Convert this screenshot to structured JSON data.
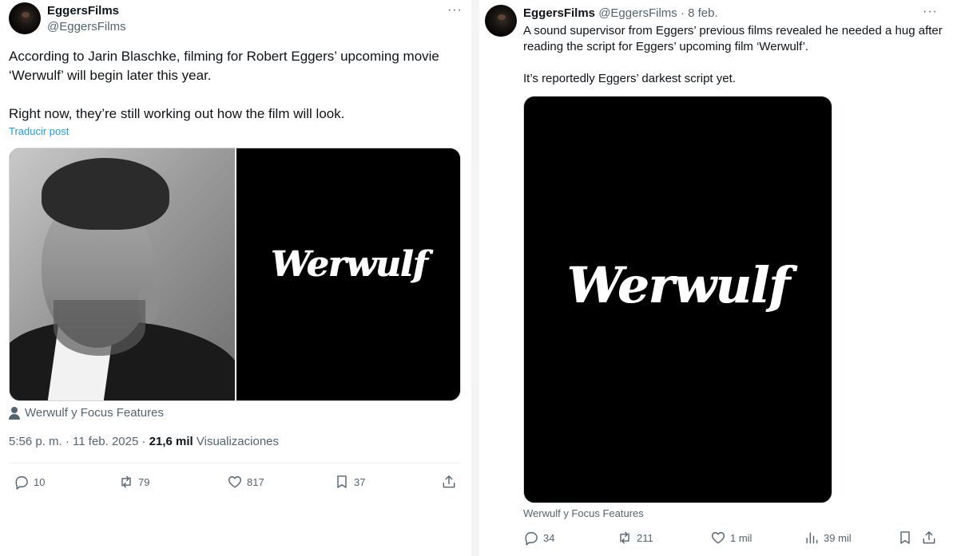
{
  "left_tweet": {
    "author_name": "EggersFilms",
    "author_handle": "@EggersFilms",
    "text": "According to Jarin Blaschke, filming for Robert Eggers’ upcoming movie ‘Werwulf’ will begin later this year.\n\nRight now, they’re still working out how the film will look.",
    "translate_label": "Traducir post",
    "media_wordmark": "Werwulf",
    "media_credit": "Werwulf y Focus Features",
    "timestamp": "5:56 p. m. · 11 feb. 2025 · ",
    "views_count": "21,6 mil",
    "views_label": " Visualizaciones",
    "stats": {
      "replies": "10",
      "reposts": "79",
      "likes": "817",
      "bookmarks": "37"
    }
  },
  "right_tweet": {
    "author_name": "EggersFilms",
    "author_handle": "@EggersFilms",
    "date": " · 8 feb.",
    "text": "A sound supervisor from Eggers’ previous films revealed he needed a hug after reading the script for Eggers’ upcoming film ‘Werwulf’.\n\nIt’s reportedly Eggers’ darkest script yet.",
    "media_wordmark": "Werwulf",
    "media_credit": "Werwulf y Focus Features",
    "stats": {
      "replies": "34",
      "reposts": "211",
      "likes": "1 mil",
      "views": "39 mil"
    }
  },
  "colors": {
    "text": "#0f1419",
    "secondary": "#536471",
    "link": "#1d9bf0",
    "border": "#cfd9de"
  },
  "icons": [
    "more-icon",
    "reply-icon",
    "repost-icon",
    "like-icon",
    "bookmark-icon",
    "share-icon",
    "views-icon",
    "person-icon"
  ]
}
